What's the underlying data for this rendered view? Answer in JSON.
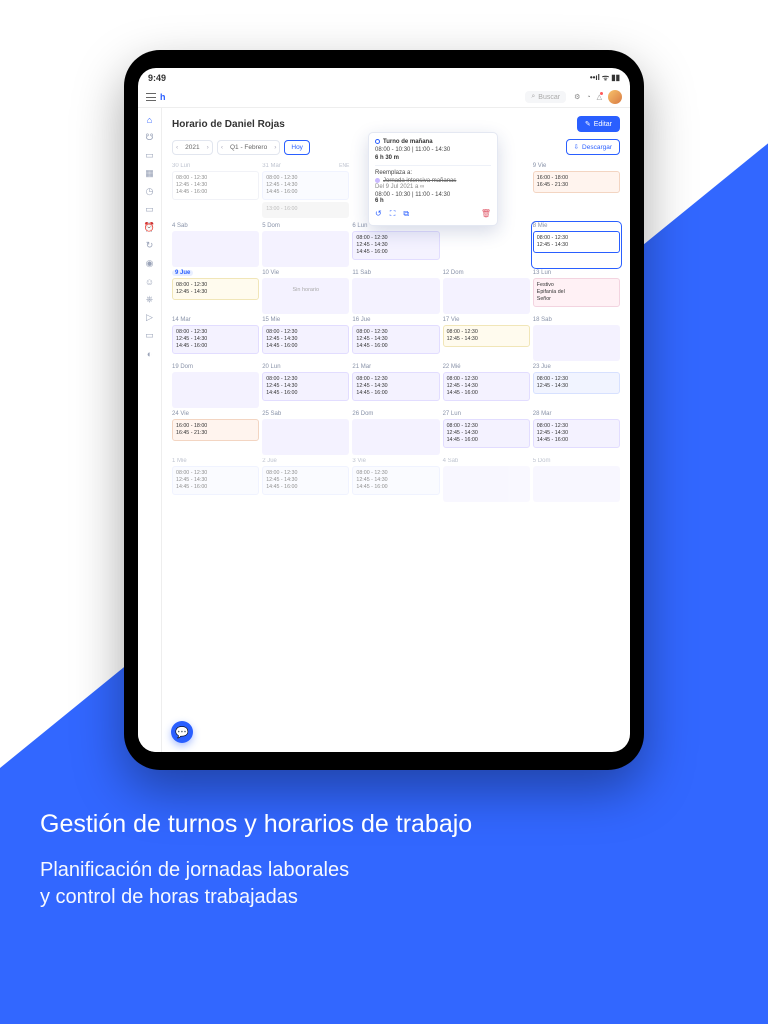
{
  "promo": {
    "headline": "Gestión de turnos y horarios de trabajo",
    "sub": "Planificación de jornadas laborales\ny control de horas trabajadas"
  },
  "status": {
    "time": "9:49"
  },
  "search": {
    "placeholder": "Buscar"
  },
  "page": {
    "title": "Horario de Daniel Rojas",
    "edit": "Editar",
    "today": "Hoy",
    "download": "Descargar"
  },
  "nav": {
    "year": "2021",
    "period": "Q1 - Febrero"
  },
  "popover": {
    "shift": "Turno de mañana",
    "range": "08:00 - 10:30  |  11:00 - 14:30",
    "duration": "6 h 30 m",
    "replaces_lbl": "Reemplaza a:",
    "replaces": "Jornada intensiva mañanas",
    "replaces_date": "Del 9 Jul 2021 a ∞",
    "old_range": "08:00 - 10:30  |  11:00 - 14:30",
    "old_duration": "6 h"
  },
  "days": [
    {
      "h": "30 Lun",
      "faded": true,
      "cards": [
        {
          "cls": "c-plain",
          "l": [
            "08:00 - 12:30",
            "12:45 - 14:30",
            "14:45 - 16:00"
          ]
        }
      ]
    },
    {
      "h": "31 Mar",
      "r": "ENE",
      "faded": true,
      "cards": [
        {
          "cls": "c-lblue",
          "l": [
            "08:00 - 12:30",
            "12:45 - 14:30",
            "14:45 - 16:00"
          ]
        },
        {
          "cls": "c-gray",
          "l": [
            "13:00 - 16:00"
          ]
        }
      ]
    },
    {
      "h": "",
      "cards": []
    },
    {
      "h": "",
      "cards": []
    },
    {
      "h": "9 Vie",
      "cards": [
        {
          "cls": "c-orange",
          "l": [
            "16:00 - 18:00",
            "16:45 - 21:30"
          ]
        }
      ]
    },
    {
      "h": "4 Sab",
      "empty": true
    },
    {
      "h": "5 Dom",
      "empty": true
    },
    {
      "h": "6 Lun",
      "cards": [
        {
          "cls": "c-purple",
          "l": [
            "08:00 - 12:30",
            "12:45 - 14:30",
            "14:45 - 16:00"
          ]
        }
      ]
    },
    {
      "h": "",
      "cards": []
    },
    {
      "h": "8 Mie",
      "sel": true,
      "cards": [
        {
          "cls": "c-outblue",
          "l": [
            "08:00 - 12:30",
            "12:45 - 14:30"
          ]
        }
      ]
    },
    {
      "h": "9 Jue",
      "hl": true,
      "cards": [
        {
          "cls": "c-yellow",
          "l": [
            "08:00 - 12:30",
            "12:45 - 14:30"
          ]
        }
      ]
    },
    {
      "h": "10 Vie",
      "sin": "Sin horario"
    },
    {
      "h": "11 Sab",
      "empty": true
    },
    {
      "h": "12 Dom",
      "empty": true
    },
    {
      "h": "13 Lun",
      "cards": [
        {
          "cls": "c-pink",
          "l": [
            "Festivo",
            "Epifanía del",
            "Señor"
          ]
        }
      ]
    },
    {
      "h": "14 Mar",
      "cards": [
        {
          "cls": "c-purple",
          "l": [
            "08:00 - 12:30",
            "12:45 - 14:30",
            "14:45 - 16:00"
          ]
        }
      ]
    },
    {
      "h": "15 Mie",
      "cards": [
        {
          "cls": "c-purple",
          "l": [
            "08:00 - 12:30",
            "12:45 - 14:30",
            "14:45 - 16:00"
          ]
        }
      ]
    },
    {
      "h": "16 Jue",
      "cards": [
        {
          "cls": "c-purple",
          "l": [
            "08:00 - 12:30",
            "12:45 - 14:30",
            "14:45 - 16:00"
          ]
        }
      ]
    },
    {
      "h": "17 Vie",
      "cards": [
        {
          "cls": "c-yellow",
          "l": [
            "08:00 - 12:30",
            "12:45 - 14:30"
          ]
        }
      ]
    },
    {
      "h": "18 Sab",
      "empty": true
    },
    {
      "h": "19 Dom",
      "empty": true
    },
    {
      "h": "20 Lun",
      "cards": [
        {
          "cls": "c-purple",
          "l": [
            "08:00 - 12:30",
            "12:45 - 14:30",
            "14:45 - 16:00"
          ]
        }
      ]
    },
    {
      "h": "21 Mar",
      "cards": [
        {
          "cls": "c-purple",
          "l": [
            "08:00 - 12:30",
            "12:45 - 14:30",
            "14:45 - 16:00"
          ]
        }
      ]
    },
    {
      "h": "22 Mié",
      "cards": [
        {
          "cls": "c-purple",
          "l": [
            "08:00 - 12:30",
            "12:45 - 14:30",
            "14:45 - 16:00"
          ]
        }
      ]
    },
    {
      "h": "23 Jue",
      "cards": [
        {
          "cls": "c-blue",
          "l": [
            "08:00 - 12:30",
            "12:45 - 14:30"
          ]
        }
      ]
    },
    {
      "h": "24 Vie",
      "cards": [
        {
          "cls": "c-orange",
          "l": [
            "16:00 - 18:00",
            "16:45 - 21:30"
          ]
        }
      ]
    },
    {
      "h": "25 Sab",
      "empty": true
    },
    {
      "h": "26 Dom",
      "empty": true
    },
    {
      "h": "27 Lun",
      "cards": [
        {
          "cls": "c-purple",
          "l": [
            "08:00 - 12:30",
            "12:45 - 14:30",
            "14:45 - 16:00"
          ]
        }
      ]
    },
    {
      "h": "28 Mar",
      "cards": [
        {
          "cls": "c-purple",
          "l": [
            "08:00 - 12:30",
            "12:45 - 14:30",
            "14:45 - 16:00"
          ]
        }
      ]
    },
    {
      "h": "1 Mie",
      "faded": true,
      "cards": [
        {
          "cls": "c-lblue",
          "l": [
            "08:00 - 12:30",
            "12:45 - 14:30",
            "14:45 - 16:00"
          ]
        }
      ]
    },
    {
      "h": "2 Jue",
      "faded": true,
      "cards": [
        {
          "cls": "c-lblue",
          "l": [
            "08:00 - 12:30",
            "12:45 - 14:30",
            "14:45 - 16:00"
          ]
        }
      ]
    },
    {
      "h": "3 Vie",
      "faded": true,
      "cards": [
        {
          "cls": "c-lblue",
          "l": [
            "08:00 - 12:30",
            "12:45 - 14:30",
            "14:45 - 16:00"
          ]
        }
      ]
    },
    {
      "h": "4 Sab",
      "faded": true,
      "empty": true
    },
    {
      "h": "5 Dom",
      "faded": true,
      "empty": true
    }
  ]
}
